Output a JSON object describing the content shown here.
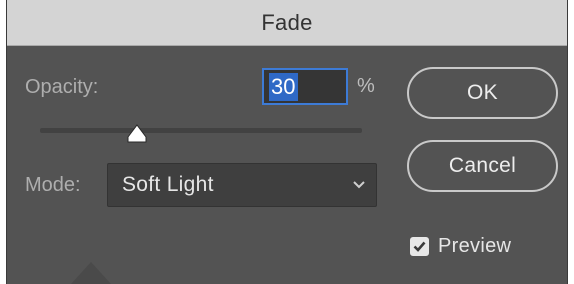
{
  "dialog": {
    "title": "Fade",
    "opacity": {
      "label": "Opacity:",
      "value": "30",
      "unit": "%",
      "slider_level_percent": 30
    },
    "mode": {
      "label": "Mode:",
      "selected": "Soft Light"
    },
    "buttons": {
      "ok": "OK",
      "cancel": "Cancel"
    },
    "preview": {
      "label": "Preview",
      "checked": true
    }
  },
  "colors": {
    "dialog_bg": "#535353",
    "titlebar_bg": "#d4d4d4",
    "focus_accent": "#3d7bd6",
    "text_selection": "#2f69c6"
  },
  "icons": {
    "slider_thumb": "triangle-slider-thumb-icon",
    "dropdown": "chevron-down-icon",
    "checkbox": "checkmark-icon"
  }
}
